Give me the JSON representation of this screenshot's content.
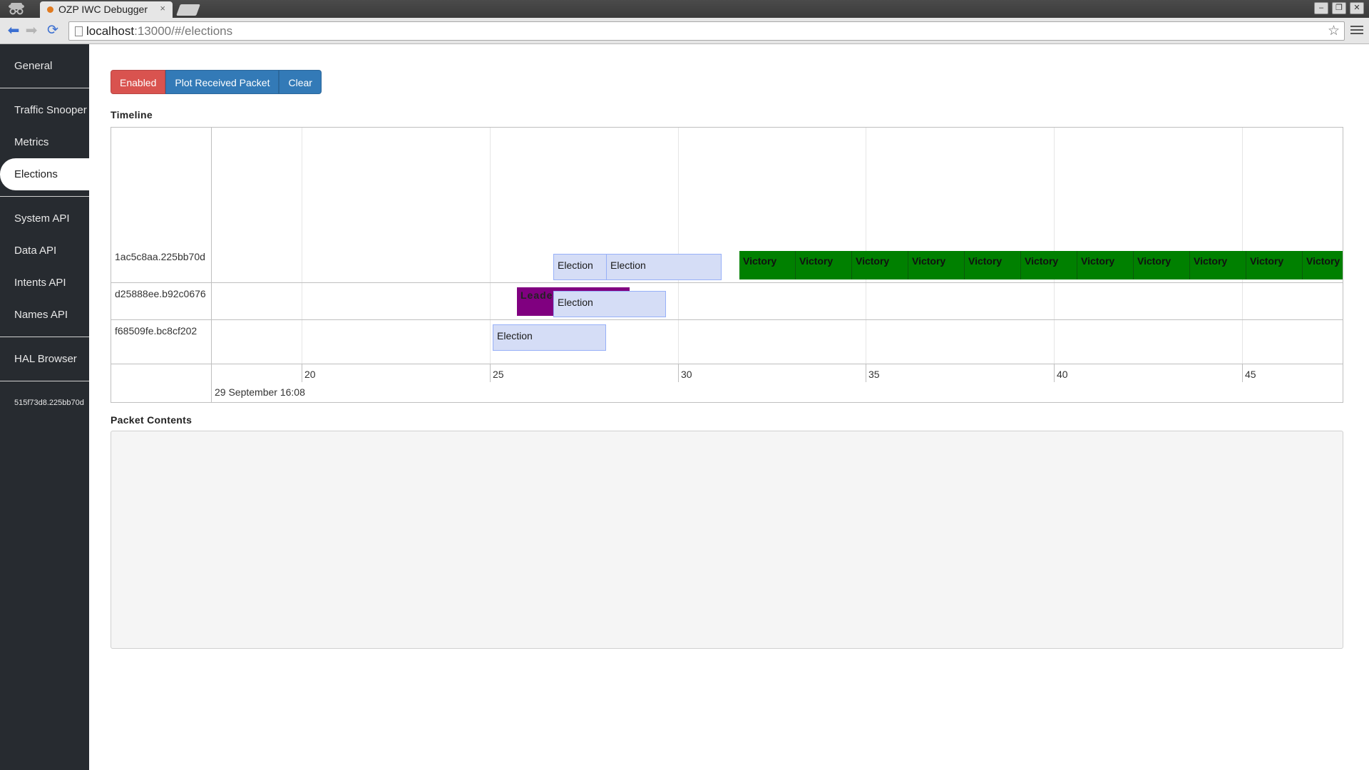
{
  "browser": {
    "tab_title": "OZP IWC Debugger",
    "tab_close": "×",
    "url_host": "localhost",
    "url_rest": ":13000/#/elections",
    "star": "☆"
  },
  "sidebar": {
    "groups": [
      [
        "General"
      ],
      [
        "Traffic Snooper",
        "Metrics",
        "Elections"
      ],
      [
        "System API",
        "Data API",
        "Intents API",
        "Names API"
      ],
      [
        "HAL Browser"
      ]
    ],
    "active": "Elections",
    "client_id": "515f73d8.225bb70d"
  },
  "controls": {
    "enabled_label": "Enabled",
    "plot_label": "Plot Received Packet",
    "clear_label": "Clear"
  },
  "timeline": {
    "title": "Timeline",
    "rows": [
      "1ac5c8aa.225bb70d",
      "d25888ee.b92c0676",
      "f68509fe.bc8cf202"
    ],
    "axis_ticks": [
      "20",
      "25",
      "30",
      "35",
      "40",
      "45"
    ],
    "axis_date": "29 September 16:08",
    "row1": {
      "elections": [
        "Election",
        "Election"
      ],
      "victories": [
        "Victory",
        "Victory",
        "Victory",
        "Victory",
        "Victory",
        "Victory",
        "Victory",
        "Victory",
        "Victory",
        "Victory",
        "Victory"
      ]
    },
    "row2": {
      "leader": "Leader",
      "election": "Election"
    },
    "row3": {
      "election": "Election"
    },
    "colors": {
      "election": "#d5ddf6",
      "victory": "#008000",
      "leader": "#800080"
    }
  },
  "packet": {
    "title": "Packet Contents"
  }
}
